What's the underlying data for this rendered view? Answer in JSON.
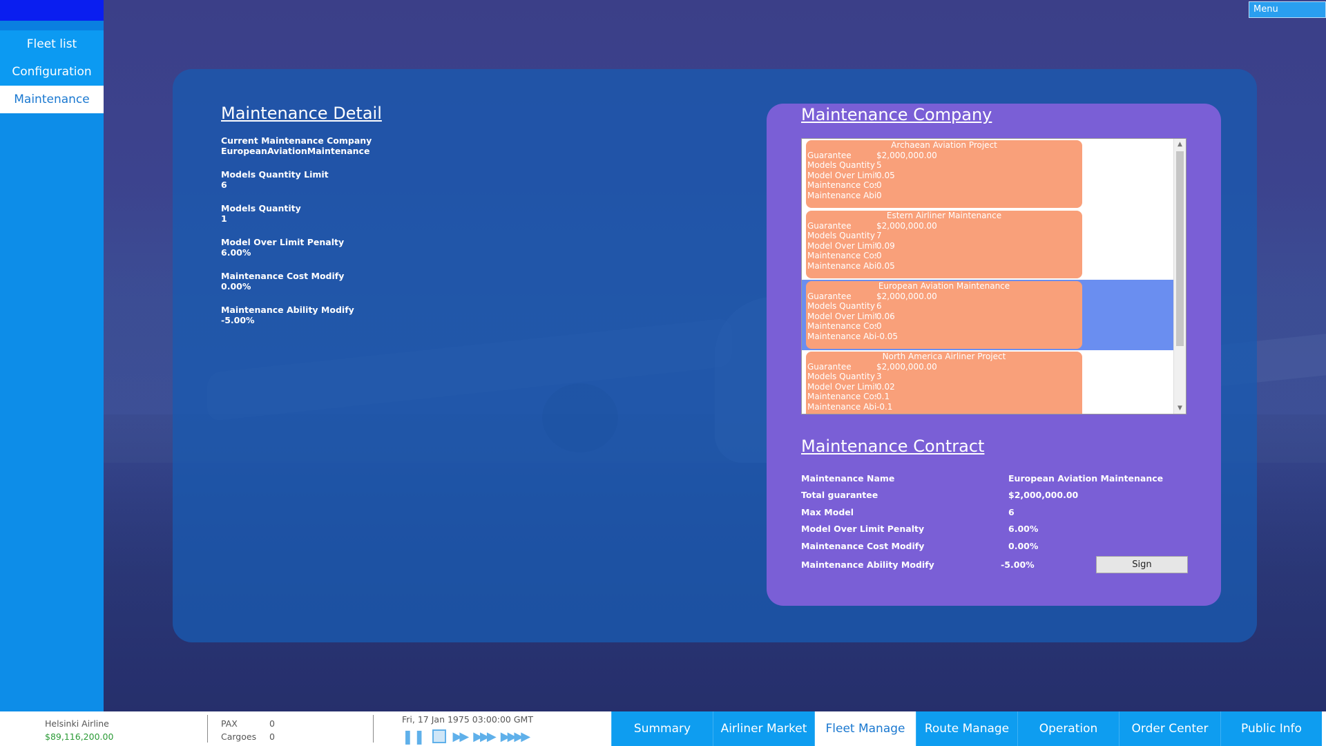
{
  "sidebar": {
    "items": [
      {
        "label": "Fleet list",
        "active": false
      },
      {
        "label": "Configuration",
        "active": false
      },
      {
        "label": "Maintenance",
        "active": true
      }
    ]
  },
  "menu_label": "Menu",
  "detail": {
    "title": "Maintenance Detail",
    "fields": [
      {
        "label": "Current Maintenance Company",
        "value": "EuropeanAviationMaintenance"
      },
      {
        "label": "Models Quantity Limit",
        "value": "6"
      },
      {
        "label": "Models Quantity",
        "value": "1"
      },
      {
        "label": "Model Over Limit Penalty",
        "value": "6.00%"
      },
      {
        "label": "Maintenance Cost Modify",
        "value": "0.00%"
      },
      {
        "label": "Maintenance Ability Modify",
        "value": "-5.00%"
      }
    ]
  },
  "company": {
    "title": "Maintenance Company",
    "row_keys": [
      "Guarantee",
      "Models Quantity",
      "Model Over Limit",
      "Maintenance Cos",
      "Maintenance Abi"
    ],
    "companies": [
      {
        "name": "Archaean Aviation Project",
        "values": [
          "$2,000,000.00",
          "5",
          "0.05",
          "0",
          "0"
        ],
        "selected": false
      },
      {
        "name": "Estern Airliner Maintenance",
        "values": [
          "$2,000,000.00",
          "7",
          "0.09",
          "0",
          "0.05"
        ],
        "selected": false
      },
      {
        "name": "European Aviation Maintenance",
        "values": [
          "$2,000,000.00",
          "6",
          "0.06",
          "0",
          "-0.05"
        ],
        "selected": true
      },
      {
        "name": "North America Airliner Project",
        "values": [
          "$2,000,000.00",
          "3",
          "0.02",
          "0.1",
          "-0.1"
        ],
        "selected": false
      }
    ]
  },
  "contract": {
    "title": "Maintenance Contract",
    "rows": [
      {
        "label": "Maintenance Name",
        "value": "European Aviation Maintenance"
      },
      {
        "label": "Total guarantee",
        "value": "$2,000,000.00"
      },
      {
        "label": "Max Model",
        "value": "6"
      },
      {
        "label": "Model Over Limit Penalty",
        "value": "6.00%"
      },
      {
        "label": "Maintenance Cost Modify",
        "value": "0.00%"
      },
      {
        "label": "Maintenance Ability Modify",
        "value": "-5.00%"
      }
    ],
    "sign_label": "Sign"
  },
  "status": {
    "airline_name": "Helsinki Airline",
    "money": "$89,116,200.00",
    "pax_label": "PAX",
    "pax_value": "0",
    "cargo_label": "Cargoes",
    "cargo_value": "0",
    "datetime": "Fri, 17 Jan 1975 03:00:00 GMT"
  },
  "tabs": [
    {
      "label": "Summary",
      "active": false
    },
    {
      "label": "Airliner Market",
      "active": false
    },
    {
      "label": "Fleet Manage",
      "active": true
    },
    {
      "label": "Route Manage",
      "active": false
    },
    {
      "label": "Operation",
      "active": false
    },
    {
      "label": "Order Center",
      "active": false
    },
    {
      "label": "Public Info",
      "active": false
    }
  ],
  "colors": {
    "accent": "#0e9df0",
    "card": "#f9a07a",
    "company_panel": "#7a5fd6",
    "money": "#2a9a35"
  }
}
